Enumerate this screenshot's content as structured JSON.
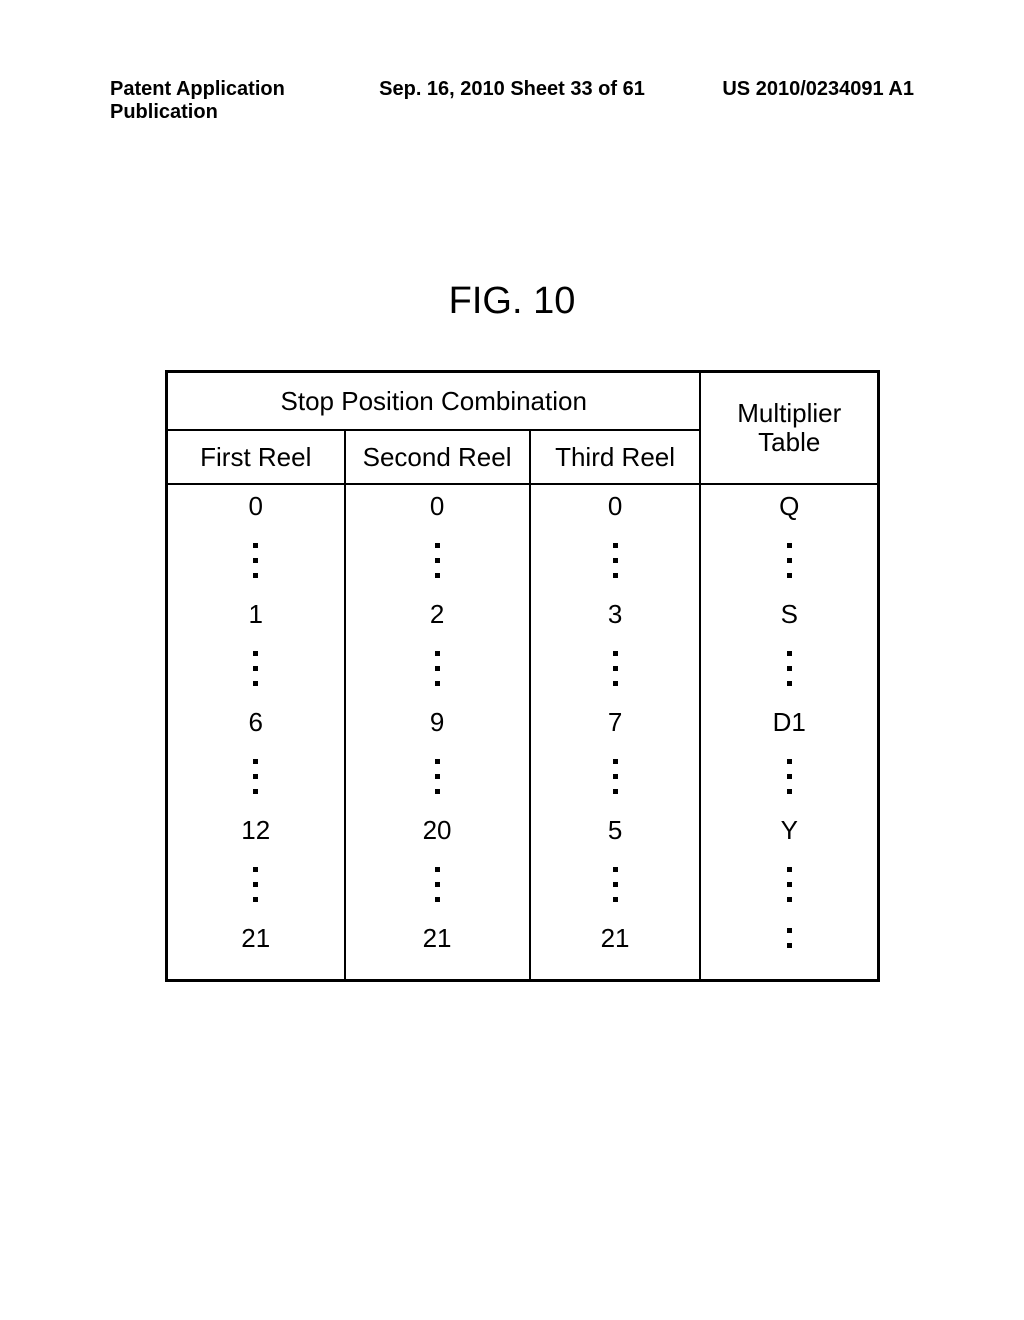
{
  "header": {
    "left": "Patent Application Publication",
    "center": "Sep. 16, 2010  Sheet 33 of 61",
    "right": "US 2010/0234091 A1"
  },
  "figure_title": "FIG. 10",
  "table": {
    "group_header": "Stop Position Combination",
    "multiplier_header_line1": "Multiplier",
    "multiplier_header_line2": "Table",
    "subheaders": {
      "first": "First Reel",
      "second": "Second Reel",
      "third": "Third Reel"
    },
    "rows": [
      {
        "first": "0",
        "second": "0",
        "third": "0",
        "mult": "Q"
      },
      {
        "first": "1",
        "second": "2",
        "third": "3",
        "mult": "S"
      },
      {
        "first": "6",
        "second": "9",
        "third": "7",
        "mult": "D1"
      },
      {
        "first": "12",
        "second": "20",
        "third": "5",
        "mult": "Y"
      },
      {
        "first": "21",
        "second": "21",
        "third": "21",
        "mult": ""
      }
    ]
  },
  "chart_data": {
    "type": "table",
    "title": "FIG. 10",
    "columns": [
      "First Reel",
      "Second Reel",
      "Third Reel",
      "Multiplier Table"
    ],
    "group_header": "Stop Position Combination",
    "rows_shown": [
      [
        "0",
        "0",
        "0",
        "Q"
      ],
      [
        "1",
        "2",
        "3",
        "S"
      ],
      [
        "6",
        "9",
        "7",
        "D1"
      ],
      [
        "12",
        "20",
        "5",
        "Y"
      ],
      [
        "21",
        "21",
        "21",
        ""
      ]
    ],
    "ellipsis_between_rows": true,
    "note": "Vertical ellipses appear between each shown row and after the last Multiplier entry, indicating additional unspecified rows."
  }
}
